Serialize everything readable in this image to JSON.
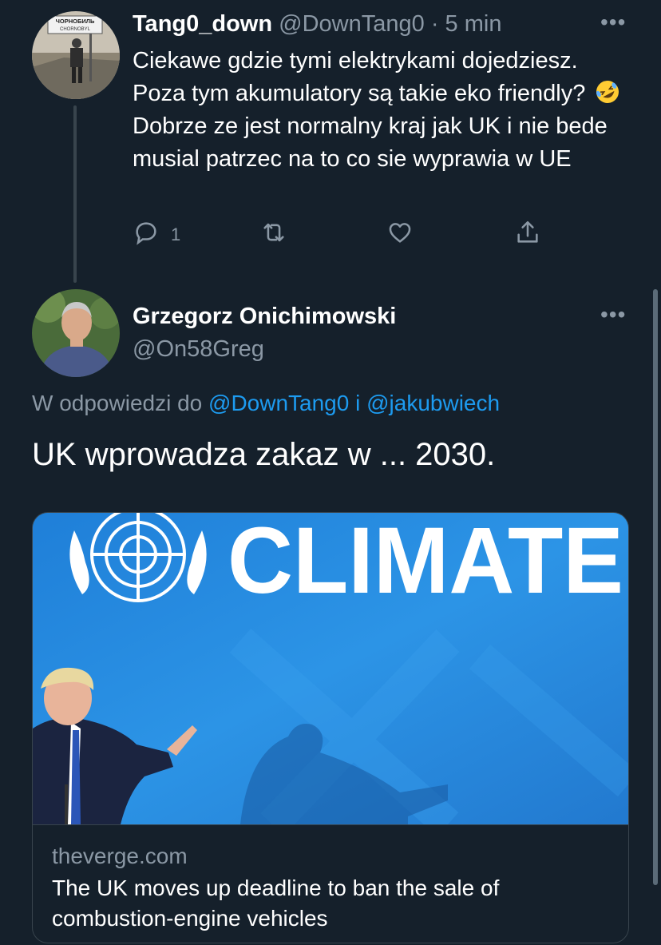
{
  "reply_tweet": {
    "display_name": "Tang0_down",
    "handle": "@DownTang0",
    "separator": "·",
    "time": "5 min",
    "more_icon": "more-horizontal-icon",
    "text_part1": "Ciekawe gdzie tymi elektrykami dojedziesz. Poza tym akumulatory są takie eko friendly?",
    "emoji": "rolling-on-floor-laughing",
    "text_part2": "Dobrze ze jest normalny kraj jak UK i nie bede musial patrzec na to co sie wyprawia w UE",
    "avatar_sign_line1": "ЧОРНОБИЛЬ",
    "avatar_sign_line2": "CHORNOBYL",
    "actions": {
      "reply_count": "1",
      "retweet_count": "",
      "like_count": ""
    }
  },
  "main_tweet": {
    "display_name": "Grzegorz Onichimowski",
    "handle": "@On58Greg",
    "reply_prefix": "W odpowiedzi do",
    "reply_user1": "@DownTang0",
    "reply_joiner": "i",
    "reply_user2": "@jakubwiech",
    "text": "UK wprowadza zakaz w ... 2030.",
    "card": {
      "image_headline": "CLIMATE",
      "domain": "theverge.com",
      "title": "The UK moves up deadline to ban the sale of combustion-engine vehicles"
    }
  },
  "colors": {
    "background": "#15202b",
    "link": "#1d9bf0",
    "muted": "#8b98a5",
    "border": "#38444d"
  }
}
